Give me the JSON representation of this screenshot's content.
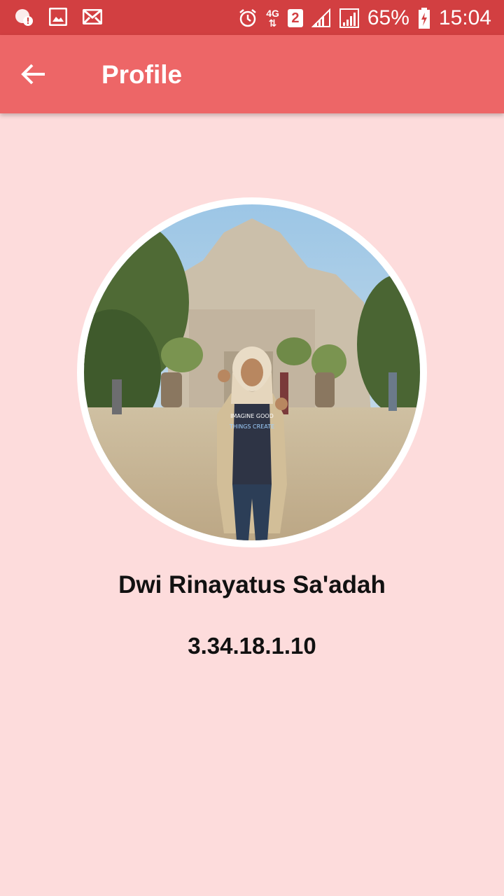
{
  "status_bar": {
    "network": "4G",
    "sim_slot": "2",
    "battery": "65%",
    "time": "15:04",
    "icons": [
      "notification-alert-icon",
      "gallery-icon",
      "mail-icon",
      "alarm-icon",
      "network-4g-icon",
      "signal-icon",
      "battery-charging-icon"
    ]
  },
  "app_bar": {
    "title": "Profile",
    "back_icon": "arrow-back-icon",
    "color": "#ed6667"
  },
  "profile": {
    "name": "Dwi Rinayatus Sa'adah",
    "id_number": "3.34.18.1.10",
    "shirt_text": [
      "IMAGINE GOOD",
      "THINGS CREATE"
    ]
  },
  "colors": {
    "status_bar": "#d23f41",
    "background": "#fddcdc",
    "text": "#111111"
  }
}
